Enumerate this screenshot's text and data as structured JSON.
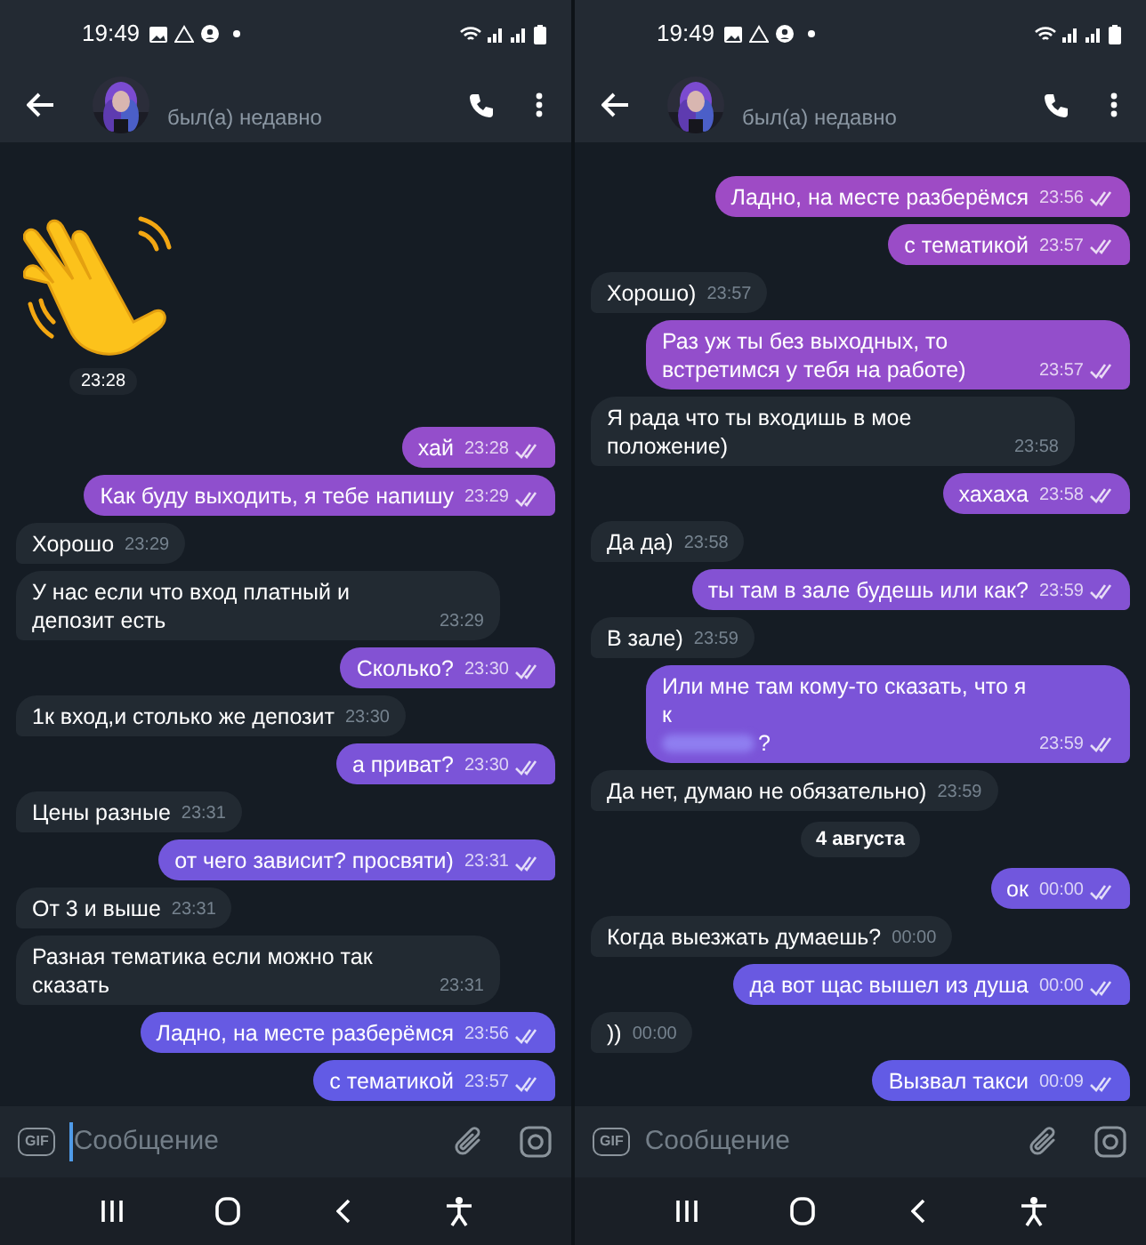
{
  "screens": [
    {
      "status_bar": {
        "time": "19:49"
      },
      "header": {
        "status": "был(а) недавно"
      },
      "messages": [
        {
          "kind": "sticker",
          "outgoing": false,
          "time": "23:28"
        },
        {
          "kind": "message",
          "outgoing": true,
          "text": "хай",
          "time": "23:28",
          "read": true
        },
        {
          "kind": "message",
          "outgoing": true,
          "text": "Как буду выходить, я тебе напишу",
          "time": "23:29",
          "read": true
        },
        {
          "kind": "message",
          "outgoing": false,
          "text": "Хорошо",
          "time": "23:29"
        },
        {
          "kind": "message",
          "outgoing": false,
          "text": "У нас если что вход платный и депозит есть",
          "time": "23:29"
        },
        {
          "kind": "message",
          "outgoing": true,
          "text": "Сколько?",
          "time": "23:30",
          "read": true
        },
        {
          "kind": "message",
          "outgoing": false,
          "text": "1к вход,и столько же депозит",
          "time": "23:30"
        },
        {
          "kind": "message",
          "outgoing": true,
          "text": "а приват?",
          "time": "23:30",
          "read": true
        },
        {
          "kind": "message",
          "outgoing": false,
          "text": "Цены разные",
          "time": "23:31"
        },
        {
          "kind": "message",
          "outgoing": true,
          "text": "от чего зависит? просвяти)",
          "time": "23:31",
          "read": true
        },
        {
          "kind": "message",
          "outgoing": false,
          "text": "От 3 и выше",
          "time": "23:31"
        },
        {
          "kind": "message",
          "outgoing": false,
          "text": "Разная тематика если можно так сказать",
          "time": "23:31"
        },
        {
          "kind": "message",
          "outgoing": true,
          "text": "Ладно, на месте разберёмся",
          "time": "23:56",
          "read": true
        },
        {
          "kind": "message",
          "outgoing": true,
          "text": "с тематикой",
          "time": "23:57",
          "read": true
        }
      ],
      "composer": {
        "badge": "GIF",
        "placeholder": "Сообщение",
        "focused": true
      }
    },
    {
      "status_bar": {
        "time": "19:49"
      },
      "header": {
        "status": "был(а) недавно"
      },
      "messages": [
        {
          "kind": "message",
          "outgoing": true,
          "text": "Ладно, на месте разберёмся",
          "time": "23:56",
          "read": true
        },
        {
          "kind": "message",
          "outgoing": true,
          "text": "с тематикой",
          "time": "23:57",
          "read": true
        },
        {
          "kind": "message",
          "outgoing": false,
          "text": "Хорошо)",
          "time": "23:57"
        },
        {
          "kind": "message",
          "outgoing": true,
          "text": "Раз уж ты без выходных, то встретимся у тебя на работе)",
          "time": "23:57",
          "read": true
        },
        {
          "kind": "message",
          "outgoing": false,
          "text": "Я рада что ты входишь в мое положение)",
          "time": "23:58"
        },
        {
          "kind": "message",
          "outgoing": true,
          "text": "хахаха",
          "time": "23:58",
          "read": true
        },
        {
          "kind": "message",
          "outgoing": false,
          "text": "Да да)",
          "time": "23:58"
        },
        {
          "kind": "message",
          "outgoing": true,
          "text": "ты там в зале будешь или как?",
          "time": "23:59",
          "read": true
        },
        {
          "kind": "message",
          "outgoing": false,
          "text": "В зале)",
          "time": "23:59"
        },
        {
          "kind": "message",
          "outgoing": true,
          "text": "Или мне там кому-то сказать, что я к",
          "redacted": true,
          "text_after": "?",
          "time": "23:59",
          "read": true
        },
        {
          "kind": "message",
          "outgoing": false,
          "text": "Да нет, думаю не обязательно)",
          "time": "23:59"
        },
        {
          "kind": "date",
          "text": "4 августа"
        },
        {
          "kind": "message",
          "outgoing": true,
          "text": "ок",
          "time": "00:00",
          "read": true
        },
        {
          "kind": "message",
          "outgoing": false,
          "text": "Когда выезжать думаешь?",
          "time": "00:00"
        },
        {
          "kind": "message",
          "outgoing": true,
          "text": "да вот щас вышел из душа",
          "time": "00:00",
          "read": true
        },
        {
          "kind": "message",
          "outgoing": false,
          "text": "))",
          "time": "00:00"
        },
        {
          "kind": "message",
          "outgoing": true,
          "text": "Вызвал такси",
          "time": "00:09",
          "read": true
        }
      ],
      "composer": {
        "badge": "GIF",
        "placeholder": "Сообщение",
        "focused": false
      }
    }
  ]
}
